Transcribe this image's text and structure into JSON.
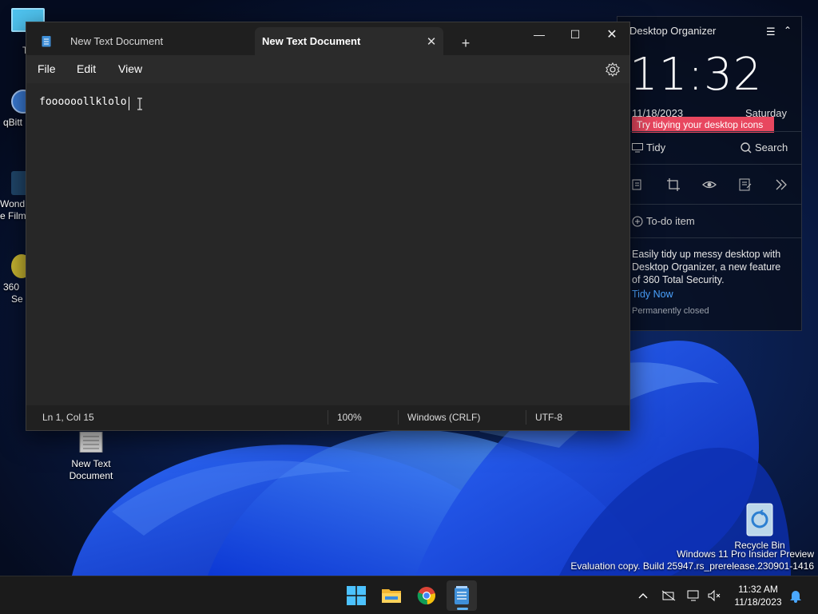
{
  "desktop": {
    "icons": [
      {
        "label_line1": "Th",
        "label_line2": ""
      },
      {
        "label_line1": "qBitt",
        "label_line2": ""
      },
      {
        "label_line1": "Wond",
        "label_line2": "e Film"
      },
      {
        "label_line1": "360",
        "label_line2": "Se"
      },
      {
        "label_line1": "New Text",
        "label_line2": "Document"
      },
      {
        "label_line1": "Recycle Bin",
        "label_line2": ""
      }
    ]
  },
  "notepad": {
    "tabs": [
      {
        "title": "New Text Document",
        "active": false
      },
      {
        "title": "New Text Document",
        "active": true
      }
    ],
    "tab_close_glyph": "✕",
    "new_tab_glyph": "+",
    "window_controls": {
      "minimize": "—",
      "maximize": "☐",
      "close": "✕"
    },
    "menu": [
      "File",
      "Edit",
      "View"
    ],
    "content": "foooooollklolo",
    "status": {
      "position": "Ln 1, Col 15",
      "zoom": "100%",
      "line_ending": "Windows (CRLF)",
      "encoding": "UTF-8"
    }
  },
  "organizer": {
    "title": "Desktop Organizer",
    "menu_glyph": "☰",
    "collapse_glyph": "⌃",
    "time": "11:32",
    "date": "11/18/2023",
    "day": "Saturday",
    "tip": "Try tidying your desktop icons",
    "tidy_label": "Tidy",
    "search_label": "Search",
    "todo_label": "To-do item",
    "description": "Easily tidy up messy desktop with Desktop Organizer, a new feature of 360 Total Security.",
    "tidy_now": "Tidy Now",
    "permanently_closed": "Permanently closed"
  },
  "watermark": {
    "line1": "Windows 11 Pro Insider Preview",
    "line2": "Evaluation copy. Build 25947.rs_prerelease.230901-1416"
  },
  "taskbar": {
    "apps": [
      "start-icon",
      "file-explorer-icon",
      "chrome-icon",
      "notepad-icon"
    ],
    "clock_time": "11:32 AM",
    "clock_date": "11/18/2023"
  },
  "colors": {
    "accent_pink": "#e8475f",
    "link_blue": "#4ba3ff",
    "taskbar_indicator": "#5fb2f2"
  }
}
